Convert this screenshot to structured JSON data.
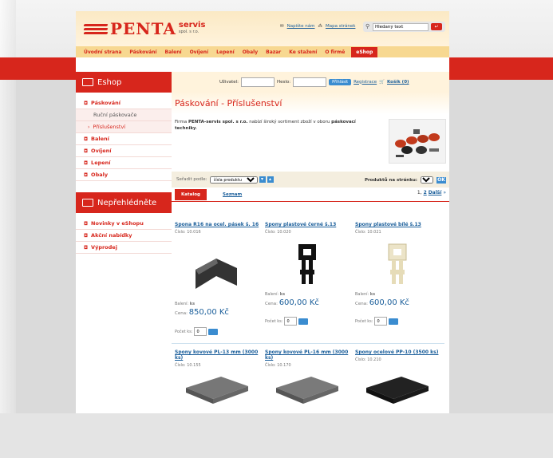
{
  "header": {
    "logo_text": "PENTA",
    "logo_sub1": "servis",
    "logo_sub2": "spol. s r.o.",
    "link_contact": "Napište nám",
    "link_sitemap": "Mapa stránek",
    "search_placeholder": "Hledaný text"
  },
  "nav": [
    "Úvodní strana",
    "Páskování",
    "Balení",
    "Ovíjení",
    "Lepení",
    "Obaly",
    "Bazar",
    "Ke stažení",
    "O firmě",
    "eShop"
  ],
  "breadcrumb": [
    "Úvodní strana",
    "eShop",
    "Páskování",
    "Příslušenství"
  ],
  "sidebar": {
    "title": "Eshop",
    "items": [
      {
        "label": "Páskování",
        "kind": "main"
      },
      {
        "label": "Ruční páskovače",
        "kind": "sub"
      },
      {
        "label": "Příslušenství",
        "kind": "current"
      },
      {
        "label": "Balení",
        "kind": "main"
      },
      {
        "label": "Ovíjení",
        "kind": "main"
      },
      {
        "label": "Lepení",
        "kind": "main"
      },
      {
        "label": "Obaly",
        "kind": "main"
      }
    ],
    "title2": "Nepřehlédněte",
    "items2": [
      "Novinky v eShopu",
      "Akční nabídky",
      "Výprodej"
    ]
  },
  "login": {
    "user_label": "Uživatel:",
    "pass_label": "Heslo:",
    "login_btn": "Přihlásit",
    "register": "Registrace",
    "cart": "Košík (0)"
  },
  "main": {
    "title": "Páskování - Příslušenství",
    "intro_1": "Firma ",
    "intro_bold": "PENTA-servis spol. s r.o.",
    "intro_2": " nabízí široký sortiment zboží v oboru ",
    "intro_bold2": "páskovací techniky",
    "intro_3": "."
  },
  "sort": {
    "label": "Seřadit podle:",
    "selected": "čísla produktu",
    "per_page_label": "Produktů na stránku:",
    "per_page": "20",
    "ok": "OK"
  },
  "tabs": {
    "catalog": "Katalog",
    "list": "Seznam"
  },
  "pager": {
    "p1": "1",
    "p2": "2",
    "next": "Další"
  },
  "products": [
    {
      "name": "Spona R16 na ocel. pásek š. 16",
      "number": "Číslo: 10.016",
      "pack_label": "Balení:",
      "pack": "ks",
      "price_label": "Cena:",
      "price": "850,00 Kč",
      "qty_label": "Počet ks:",
      "qty": "0"
    },
    {
      "name": "Spony plastové černé š.13",
      "number": "Číslo: 10.020",
      "pack_label": "Balení:",
      "pack": "ks",
      "price_label": "Cena:",
      "price": "600,00 Kč",
      "qty_label": "Počet ks:",
      "qty": "0"
    },
    {
      "name": "Spony plastové bílé š.13",
      "number": "Číslo: 10.021",
      "pack_label": "Balení:",
      "pack": "ks",
      "price_label": "Cena:",
      "price": "600,00 Kč",
      "qty_label": "Počet ks:",
      "qty": "0"
    },
    {
      "name": "Spony kovové PL-13 mm (3000 ks)",
      "number": "Číslo: 10.155"
    },
    {
      "name": "Spony kovové PL-16 mm (3000 ks)",
      "number": "Číslo: 10.170"
    },
    {
      "name": "Spony ocelové PP-10 (3500 ks)",
      "number": "Číslo: 10.210"
    }
  ],
  "colors": {
    "brand_red": "#d7261c",
    "link_blue": "#1a5e9a",
    "button_blue": "#3a8cd0",
    "nav_bg": "#f7d891"
  }
}
